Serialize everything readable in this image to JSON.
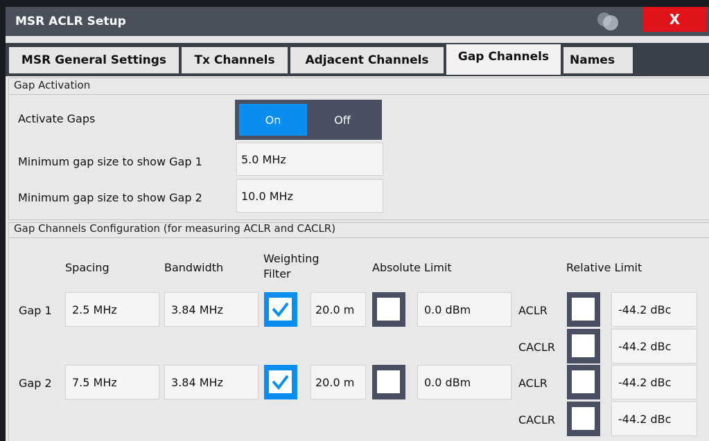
{
  "window": {
    "title": "MSR ACLR Setup",
    "close_label": "X"
  },
  "tabs": [
    {
      "label": "MSR General Settings"
    },
    {
      "label": "Tx Channels"
    },
    {
      "label": "Adjacent Channels"
    },
    {
      "label": "Gap Channels",
      "active": true
    },
    {
      "label": "Names"
    }
  ],
  "gap_activation": {
    "section_title": "Gap Activation",
    "activate_label": "Activate Gaps",
    "on_label": "On",
    "off_label": "Off",
    "selected": "On",
    "min_gap1_label": "Minimum gap size to show Gap 1",
    "min_gap1_value": "5.0 MHz",
    "min_gap2_label": "Minimum gap size to show Gap 2",
    "min_gap2_value": "10.0 MHz"
  },
  "gap_config": {
    "section_title": "Gap Channels Configuration (for measuring ACLR and CACLR)",
    "headers": {
      "spacing": "Spacing",
      "bandwidth": "Bandwidth",
      "weighting_line1": "Weighting",
      "weighting_line2": "Filter",
      "absolute_limit": "Absolute Limit",
      "relative_limit": "Relative Limit"
    },
    "gaps": [
      {
        "label": "Gap 1",
        "spacing": "2.5 MHz",
        "bandwidth": "3.84 MHz",
        "weighting_checked": true,
        "weighting_value": "20.0 m",
        "abs_checked": false,
        "abs_value": "0.0 dBm",
        "relative": [
          {
            "type": "ACLR",
            "checked": false,
            "value": "-44.2 dBc"
          },
          {
            "type": "CACLR",
            "checked": false,
            "value": "-44.2 dBc"
          }
        ]
      },
      {
        "label": "Gap 2",
        "spacing": "7.5 MHz",
        "bandwidth": "3.84 MHz",
        "weighting_checked": true,
        "weighting_value": "20.0 m",
        "abs_checked": false,
        "abs_value": "0.0 dBm",
        "relative": [
          {
            "type": "ACLR",
            "checked": false,
            "value": "-44.2 dBc"
          },
          {
            "type": "CACLR",
            "checked": false,
            "value": "-44.2 dBc"
          }
        ]
      }
    ]
  },
  "colors": {
    "accent": "#0a8ff0",
    "close": "#e0121a",
    "titlebar": "#4a4f59"
  }
}
